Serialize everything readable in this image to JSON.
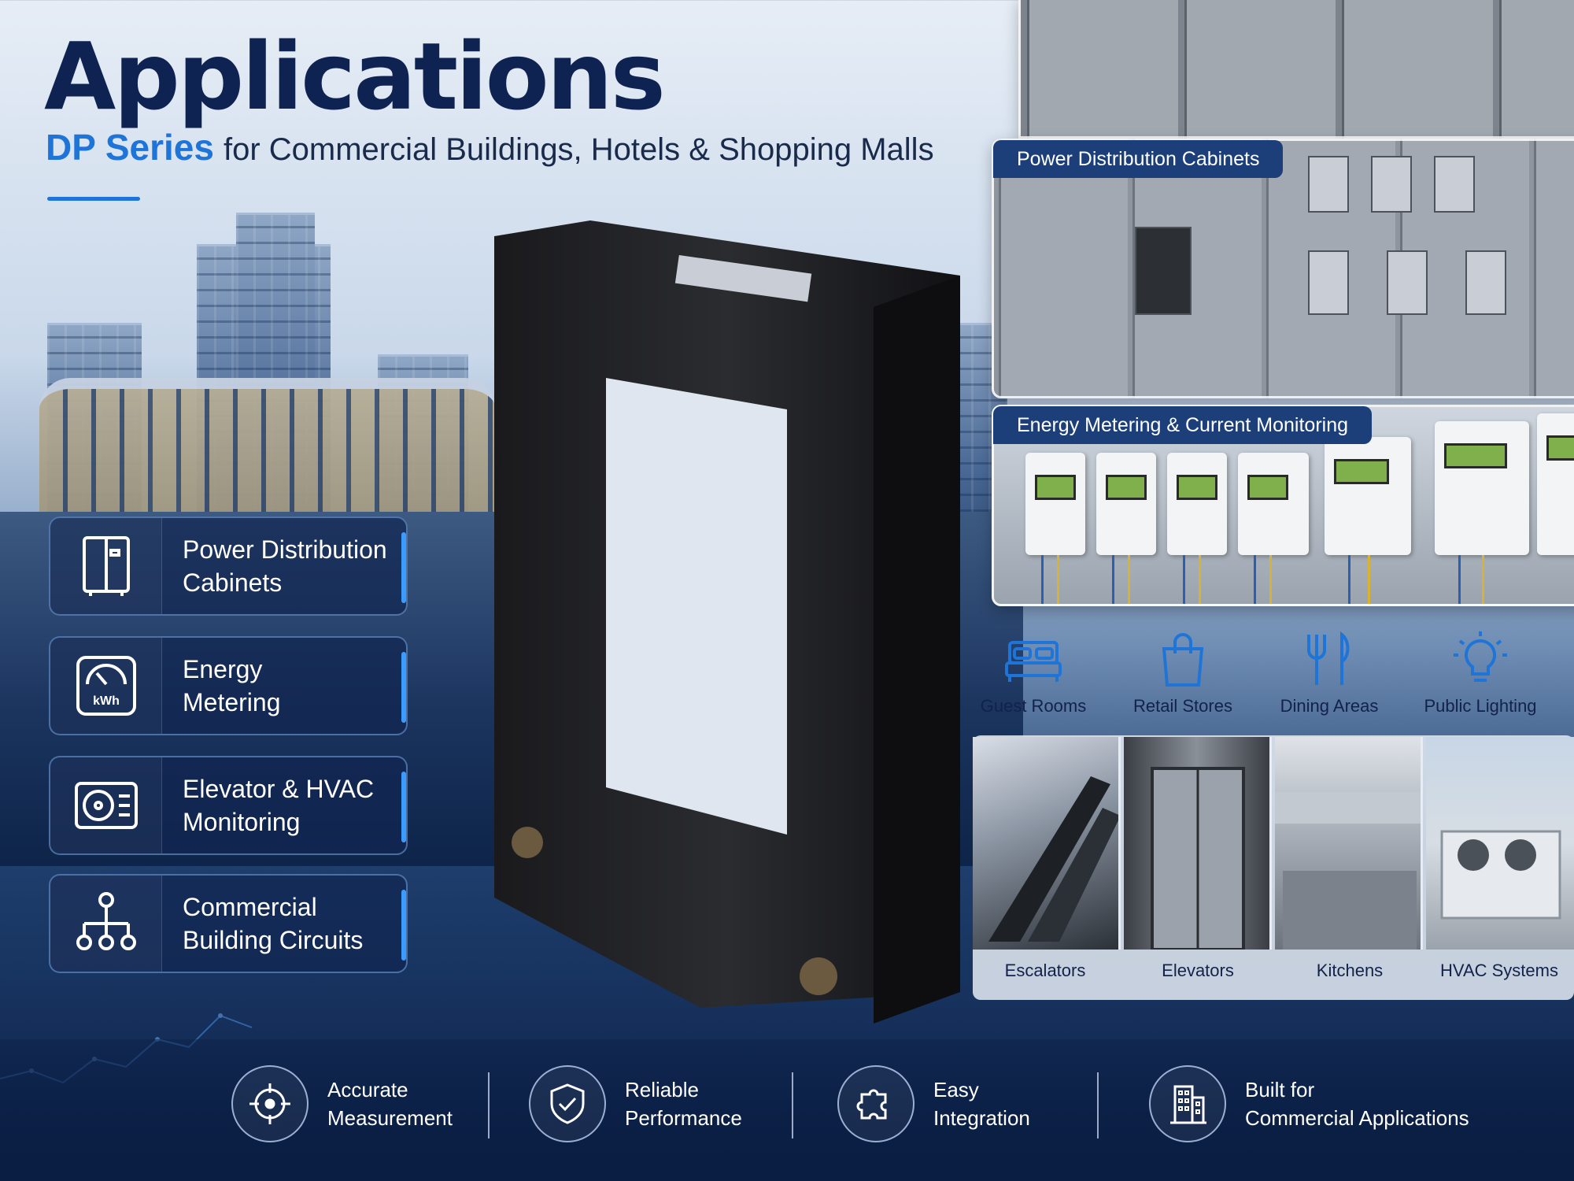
{
  "header": {
    "title": "Applications",
    "subtitle_accent": "DP Series",
    "subtitle_rest": "for Commercial Buildings, Hotels & Shopping Malls"
  },
  "features": [
    {
      "icon": "cabinet-icon",
      "line1": "Power Distribution",
      "line2": "Cabinets"
    },
    {
      "icon": "kwh-meter-icon",
      "line1": "Energy",
      "line2": "Metering",
      "icon_text": "kWh"
    },
    {
      "icon": "hvac-unit-icon",
      "line1": "Elevator & HVAC",
      "line2": "Monitoring"
    },
    {
      "icon": "circuit-tree-icon",
      "line1": "Commercial",
      "line2": "Building Circuits"
    }
  ],
  "panels": {
    "cabinets_label": "Power Distribution Cabinets",
    "metering_label": "Energy Metering & Current Monitoring"
  },
  "categories": [
    {
      "icon": "bed-icon",
      "label": "Guest Rooms"
    },
    {
      "icon": "shopping-bag-icon",
      "label": "Retail Stores"
    },
    {
      "icon": "fork-knife-icon",
      "label": "Dining Areas"
    },
    {
      "icon": "lightbulb-icon",
      "label": "Public Lighting"
    }
  ],
  "tiles": [
    {
      "label": "Escalators"
    },
    {
      "label": "Elevators"
    },
    {
      "label": "Kitchens"
    },
    {
      "label": "HVAC Systems"
    }
  ],
  "benefits": [
    {
      "icon": "crosshair-icon",
      "line1": "Accurate",
      "line2": "Measurement"
    },
    {
      "icon": "shield-check-icon",
      "line1": "Reliable",
      "line2": "Performance"
    },
    {
      "icon": "puzzle-icon",
      "line1": "Easy",
      "line2": "Integration"
    },
    {
      "icon": "building-icon",
      "line1": "Built for",
      "line2": "Commercial Applications"
    }
  ],
  "colors": {
    "navy": "#0f2352",
    "accent_blue": "#1f74d8",
    "card_border": "#3c9bff"
  }
}
